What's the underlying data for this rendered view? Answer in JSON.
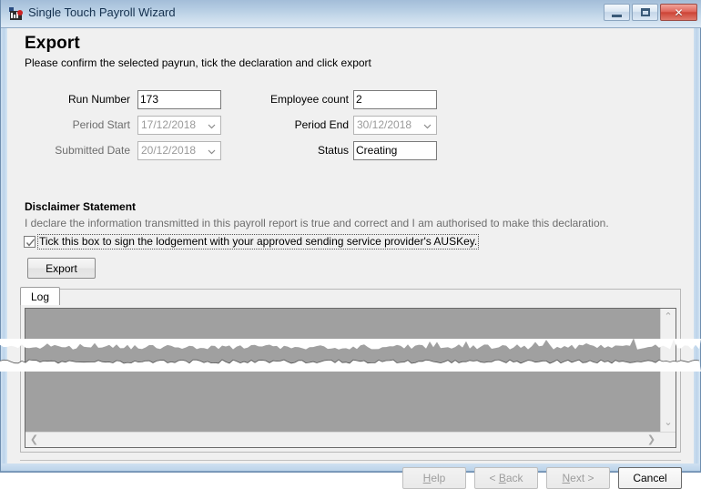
{
  "window": {
    "title": "Single Touch Payroll Wizard",
    "icon": "app-icon",
    "controls": {
      "minimize": "minimize-icon",
      "maximize": "maximize-icon",
      "close": "✕"
    }
  },
  "page": {
    "title": "Export",
    "subtitle": "Please confirm the selected payrun, tick the declaration and click export"
  },
  "form": {
    "run_number": {
      "label": "Run Number",
      "value": "173"
    },
    "employee_count": {
      "label": "Employee count",
      "value": "2"
    },
    "period_start": {
      "label": "Period Start",
      "value": "17/12/2018"
    },
    "period_end": {
      "label": "Period End",
      "value": "30/12/2018"
    },
    "submitted_date": {
      "label": "Submitted Date",
      "value": "20/12/2018"
    },
    "status": {
      "label": "Status",
      "value": "Creating"
    }
  },
  "disclaimer": {
    "heading": "Disclaimer Statement",
    "text": "I declare the information transmitted in this payroll report is true and correct and I am authorised to make this declaration.",
    "checkbox_label": "Tick this box to sign the lodgement with your approved sending service provider's AUSKey.",
    "checked": true
  },
  "actions": {
    "export": "Export"
  },
  "tabs": [
    {
      "label": "Log",
      "active": true
    }
  ],
  "log": {
    "content": "",
    "scroll_up": "⌃",
    "scroll_down": "⌄",
    "scroll_left": "❮",
    "scroll_right": "❯"
  },
  "footer": {
    "help": {
      "label": "Help",
      "mnemonic": "H",
      "enabled": false
    },
    "back": {
      "label": "< Back",
      "mnemonic": "B",
      "enabled": false
    },
    "next": {
      "label": "Next >",
      "mnemonic": "N",
      "enabled": false
    },
    "cancel": {
      "label": "Cancel",
      "enabled": true
    }
  },
  "colors": {
    "titlebar_top": "#a3bdd8",
    "titlebar_bottom": "#dde9f5",
    "frame": "#bcd4ea",
    "dialog_bg": "#f0f0f0",
    "close_button": "#cd4436",
    "log_selection": "#a0a0a0",
    "disabled_text": "#9a9a9a"
  }
}
